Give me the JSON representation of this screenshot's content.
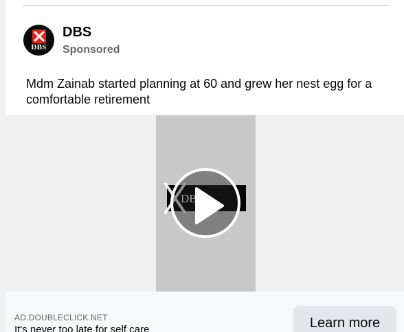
{
  "advertiser": {
    "name": "DBS",
    "sponsored_label": "Sponsored",
    "avatar_text": "DBS"
  },
  "post": {
    "caption": "Mdm Zainab started planning at 60 and grew her nest egg for a comfortable retirement"
  },
  "media": {
    "logo_text": "DBS",
    "play_icon": "play-icon",
    "brand_color": "#e1251b"
  },
  "footer": {
    "domain": "AD.DOUBLECLICK.NET",
    "tagline": "It's never too late for self care",
    "cta_label": "Learn more"
  }
}
